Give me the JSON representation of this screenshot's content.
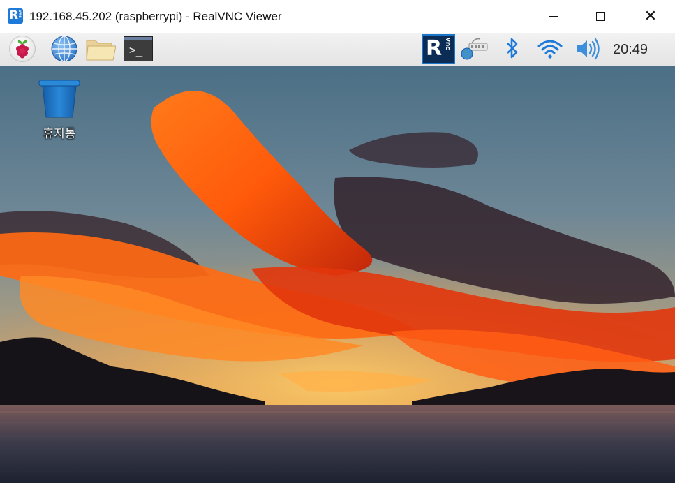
{
  "window": {
    "title": "192.168.45.202 (raspberrypi) - RealVNC Viewer",
    "controls": {
      "minimize": "minimize",
      "maximize": "maximize",
      "close": "close"
    }
  },
  "app_icon": {
    "letter": "R",
    "small": "vnc"
  },
  "panel": {
    "launchers": [
      "raspberry-menu-icon",
      "web-browser-icon",
      "file-manager-icon",
      "terminal-icon"
    ],
    "terminal_prompt": ">_",
    "tray": {
      "vnc_letter": "R",
      "vnc_small": "vnc",
      "icons": [
        "vnc-server-icon",
        "network-icon",
        "bluetooth-icon",
        "wifi-icon",
        "volume-icon"
      ]
    },
    "clock": "20:49"
  },
  "desktop": {
    "icons": [
      {
        "name": "trash-icon",
        "label": "휴지통"
      }
    ]
  },
  "colors": {
    "accent_blue": "#1e7ad8",
    "tray_blue": "#1c76c8",
    "trash_blue": "#1f7cc9"
  }
}
